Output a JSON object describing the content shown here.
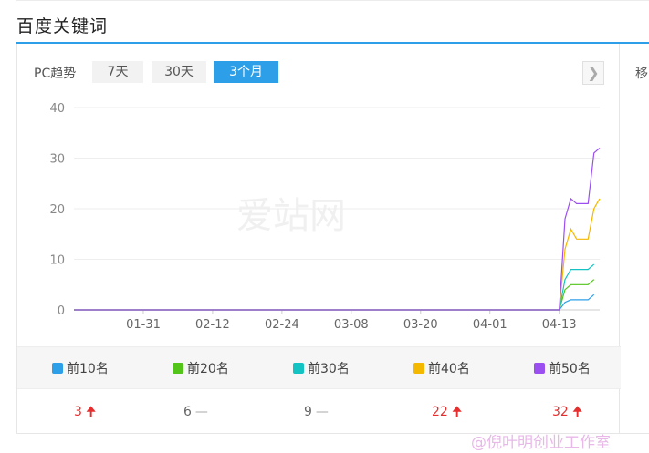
{
  "section_title": "百度关键词",
  "toolbar": {
    "label": "PC趋势",
    "tabs": [
      {
        "label": "7天",
        "active": false
      },
      {
        "label": "30天",
        "active": false
      },
      {
        "label": "3个月",
        "active": true
      }
    ],
    "next_icon": "chevron-right-icon"
  },
  "side_panel_label": "移",
  "watermark": "爱站网",
  "footer_watermark": "@倪叶明创业工作室",
  "chart_data": {
    "type": "line",
    "ylim": [
      0,
      40
    ],
    "yticks": [
      0,
      10,
      20,
      30,
      40
    ],
    "xtick_labels": [
      "01-31",
      "02-12",
      "02-24",
      "03-08",
      "03-20",
      "04-01",
      "04-13"
    ],
    "x_count": 90,
    "series": [
      {
        "name": "前10名",
        "color": "#2d9fe8",
        "values": [
          [
            0,
            0
          ],
          [
            84,
            0
          ],
          [
            85,
            1.5
          ],
          [
            86,
            2
          ],
          [
            89,
            2
          ],
          [
            90,
            3
          ]
        ]
      },
      {
        "name": "前20名",
        "color": "#52c41a",
        "values": [
          [
            0,
            0
          ],
          [
            84,
            0
          ],
          [
            85,
            4
          ],
          [
            86,
            5
          ],
          [
            89,
            5
          ],
          [
            90,
            6
          ]
        ]
      },
      {
        "name": "前30名",
        "color": "#13c2c2",
        "values": [
          [
            0,
            0
          ],
          [
            84,
            0
          ],
          [
            85,
            6
          ],
          [
            86,
            8
          ],
          [
            89,
            8
          ],
          [
            90,
            9
          ]
        ]
      },
      {
        "name": "前40名",
        "color": "#f5b800",
        "values": [
          [
            0,
            0
          ],
          [
            84,
            0
          ],
          [
            85,
            12
          ],
          [
            86,
            16
          ],
          [
            87,
            14
          ],
          [
            89,
            14
          ],
          [
            90,
            20
          ],
          [
            91,
            22
          ]
        ]
      },
      {
        "name": "前50名",
        "color": "#9b4ff0",
        "values": [
          [
            0,
            0
          ],
          [
            84,
            0
          ],
          [
            85,
            18
          ],
          [
            86,
            22
          ],
          [
            87,
            21
          ],
          [
            89,
            21
          ],
          [
            90,
            31
          ],
          [
            91,
            32
          ]
        ]
      }
    ],
    "grid": true,
    "legend_position": "bottom"
  },
  "summary": [
    {
      "value": "3",
      "trend": "up"
    },
    {
      "value": "6",
      "trend": "flat"
    },
    {
      "value": "9",
      "trend": "flat"
    },
    {
      "value": "22",
      "trend": "up"
    },
    {
      "value": "32",
      "trend": "up"
    }
  ],
  "trend_symbols": {
    "up": "🠉",
    "flat": "—"
  }
}
